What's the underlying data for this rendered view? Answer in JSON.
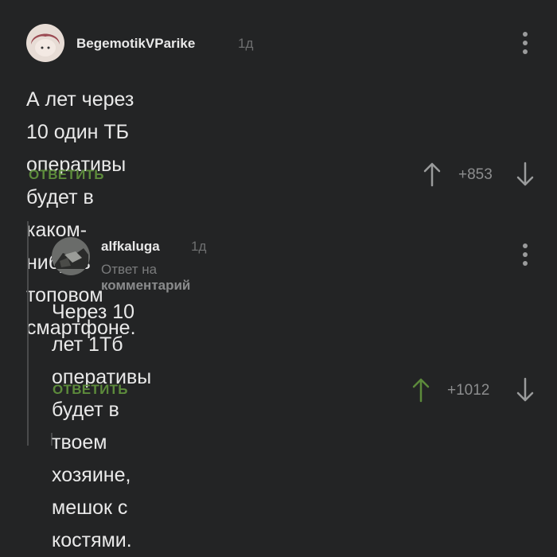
{
  "comment1": {
    "username": "BegemotikVParike",
    "time": "1д",
    "text_line1": "А лет через 10 один ТБ оперативы будет в",
    "text_line2": "каком-нибудь топовом смартфоне.",
    "reply_label": "ОТВЕТИТЬ",
    "rating": "+853"
  },
  "comment2": {
    "username": "alfkaluga",
    "time": "1д",
    "reply_to_prefix": "Ответ на",
    "reply_to_target": "комментарий",
    "text_line1": "Через 10 лет 1Тб оперативы будет в твоем",
    "text_line2": "хозяине, мешок с костями.",
    "reply_label": "ОТВЕТИТЬ",
    "rating": "+1012",
    "upvote_color": "#5c8a3b"
  },
  "icons": {
    "upvote": "arrow-up-icon",
    "downvote": "arrow-down-icon",
    "menu": "more-vertical-icon"
  }
}
